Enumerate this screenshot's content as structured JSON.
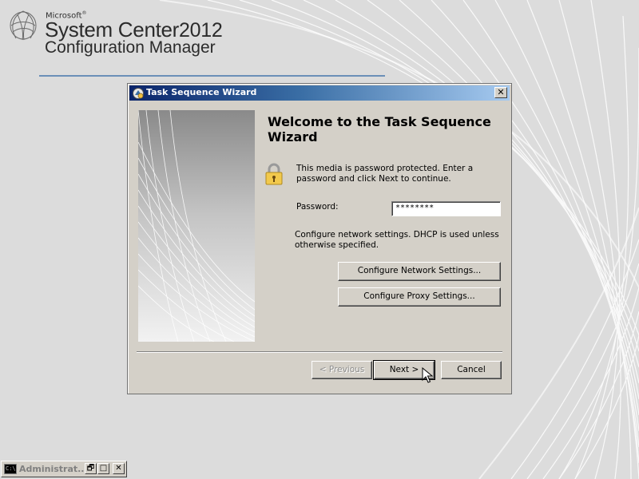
{
  "brand": {
    "microsoft": "Microsoft",
    "trademark": "®",
    "product": "System Center",
    "year": "2012",
    "subtitle": "Configuration Manager"
  },
  "dialog": {
    "title": "Task Sequence Wizard",
    "close_glyph": "✕",
    "welcome_heading": "Welcome to the Task Sequence Wizard",
    "password_message": "This media is password protected.  Enter a password and click Next to continue.",
    "password_label": "Password:",
    "password_value": "********",
    "network_message": "Configure network settings. DHCP is used unless otherwise specified.",
    "configure_network_label": "Configure Network Settings...",
    "configure_proxy_label": "Configure Proxy Settings...",
    "previous_label": "< Previous",
    "next_label": "Next >",
    "cancel_label": "Cancel"
  },
  "taskbar": {
    "icon_text": "C:\\",
    "label": "Administrat...",
    "restore_glyph": "🗗",
    "maximize_glyph": "□",
    "close_glyph": "✕"
  },
  "icons": {
    "logo": "system-center-logo",
    "title": "wizard-icon",
    "lock": "lock-icon",
    "cursor": "mouse-pointer-icon"
  },
  "colors": {
    "title_bar_start": "#0a246a",
    "title_bar_end": "#a6caf0",
    "dialog_face": "#d4d0c8",
    "brand_line": "#6b8fb8"
  }
}
